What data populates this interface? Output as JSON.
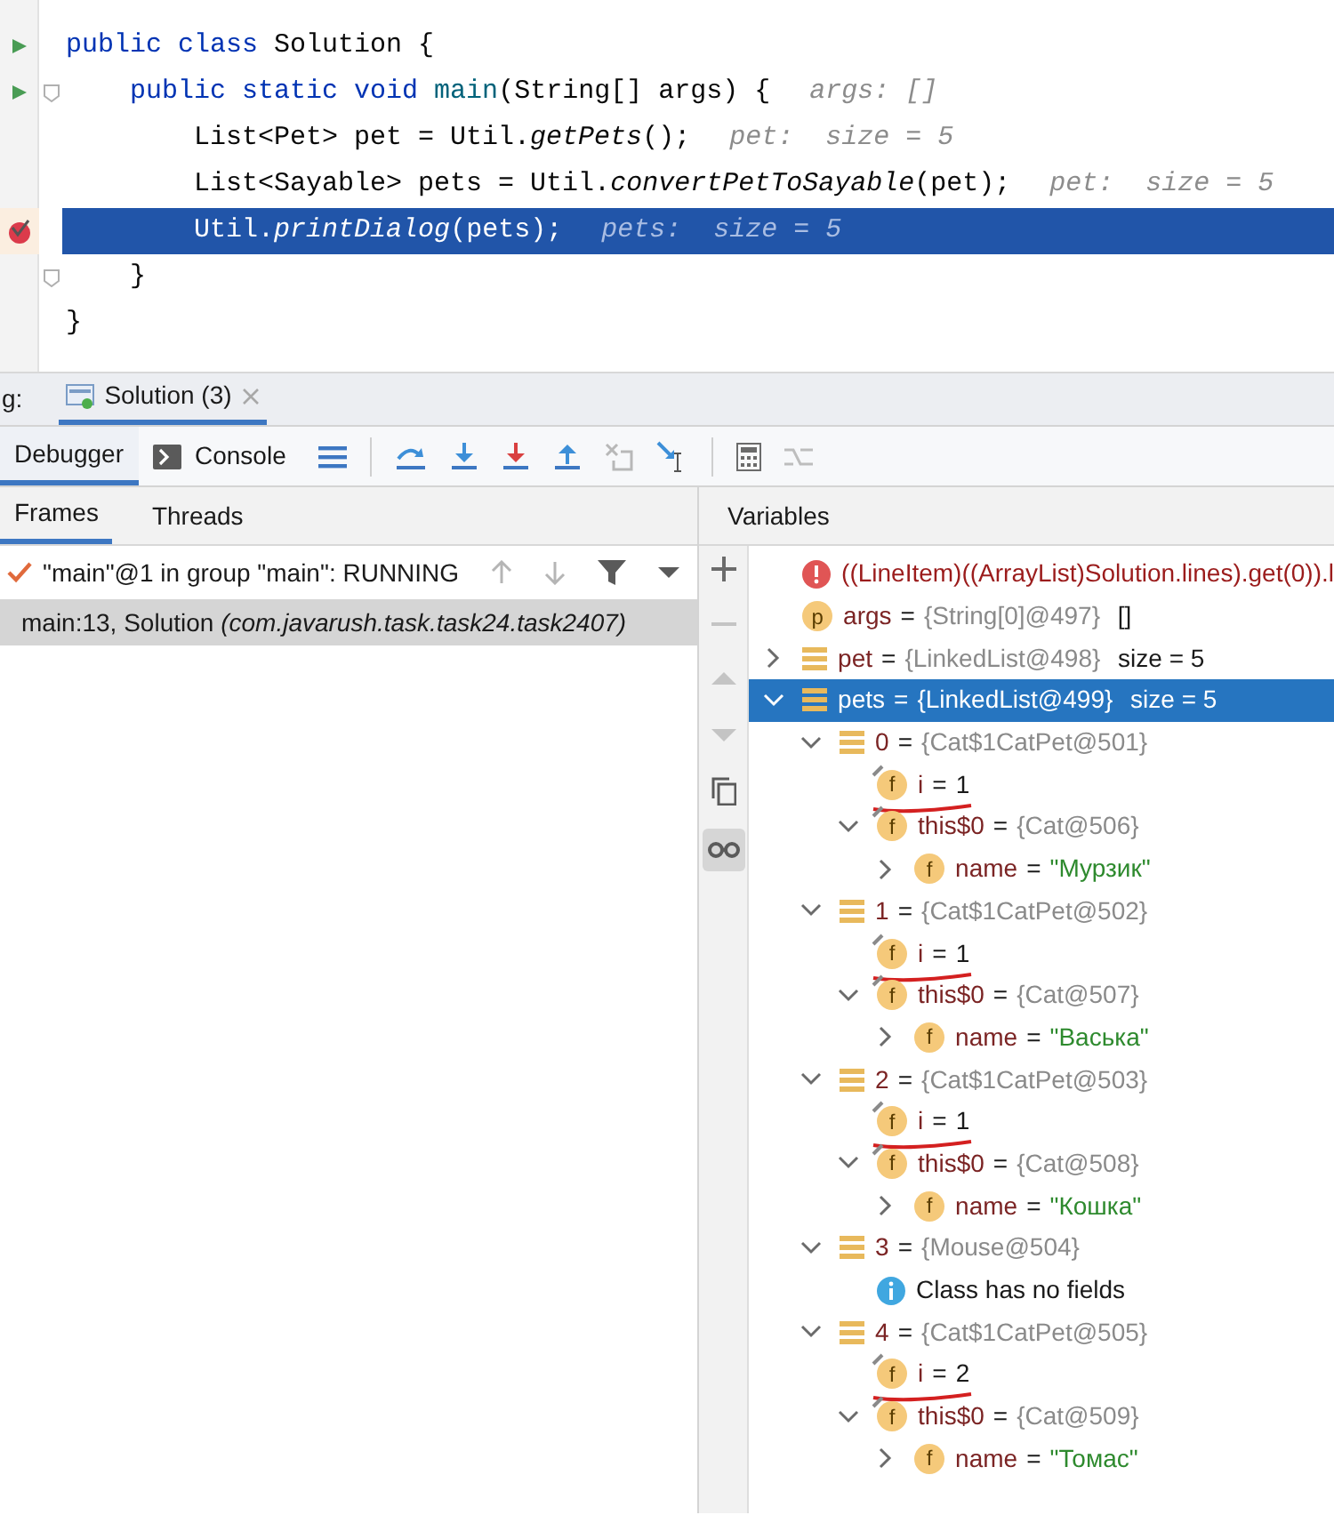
{
  "editor": {
    "lines": [
      {
        "marker": {
          "kind": "run"
        },
        "fold": false,
        "selected": false,
        "segments": [
          {
            "kind": "keyword",
            "text": "public class "
          },
          {
            "kind": "plain",
            "text": "Solution {"
          }
        ]
      },
      {
        "marker": {
          "kind": "run"
        },
        "fold": true,
        "selected": false,
        "segments": [
          {
            "kind": "keyword",
            "text": "    public static void "
          },
          {
            "kind": "decl",
            "text": "main"
          },
          {
            "kind": "plain",
            "text": "(String[] args) {"
          }
        ],
        "hint": "args: []"
      },
      {
        "fold": false,
        "selected": false,
        "segments": [
          {
            "kind": "plain",
            "text": "        List<Pet> pet = Util."
          },
          {
            "kind": "italic",
            "text": "getPets"
          },
          {
            "kind": "plain",
            "text": "();"
          }
        ],
        "hint": "pet:  size = 5"
      },
      {
        "fold": false,
        "selected": false,
        "segments": [
          {
            "kind": "plain",
            "text": "        List<Sayable> pets = Util."
          },
          {
            "kind": "italic",
            "text": "convertPetToSayable"
          },
          {
            "kind": "plain",
            "text": "(pet);"
          }
        ],
        "hint": "pet:  size = 5"
      },
      {
        "marker": {
          "kind": "breakpoint"
        },
        "fold": false,
        "selected": true,
        "segments": [
          {
            "kind": "plain",
            "text": "        Util."
          },
          {
            "kind": "italic",
            "text": "printDialog"
          },
          {
            "kind": "plain",
            "text": "(pets);"
          }
        ],
        "hint": "pets:  size = 5"
      },
      {
        "fold": true,
        "selected": false,
        "segments": [
          {
            "kind": "plain",
            "text": "    }"
          }
        ]
      },
      {
        "fold": false,
        "selected": false,
        "segments": [
          {
            "kind": "plain",
            "text": "}"
          }
        ]
      }
    ]
  },
  "debug_bar": {
    "label": "g:",
    "session_tab": {
      "label": "Solution (3)",
      "selected": true
    }
  },
  "debug_tabs": [
    {
      "label": "Debugger",
      "selected": true
    },
    {
      "label": "Console",
      "selected": false
    }
  ],
  "frames_panel": {
    "tabs": [
      {
        "label": "Frames",
        "selected": true
      },
      {
        "label": "Threads",
        "selected": false
      }
    ],
    "thread": {
      "label": "\"main\"@1 in group \"main\": RUNNING"
    },
    "frames": [
      {
        "label": "main:13, Solution *(com.javarush.task.task24.task2407)*",
        "selected": true
      }
    ]
  },
  "variables": {
    "title": "Variables",
    "tree": [
      {
        "kind": "error",
        "text": "((LineItem)((ArrayList)Solution.lines).get(0)).l",
        "selected": false
      },
      {
        "kind": "param",
        "badge": "p",
        "name": "args",
        "sep": "=",
        "value": {
          "kind": "object",
          "text": "{String[0]@497}"
        },
        "extra": "[]",
        "selected": false
      },
      {
        "kind": "list",
        "name": "pet",
        "sep": "=",
        "value": {
          "kind": "object",
          "text": "{LinkedList@498}"
        },
        "extra": "size = 5",
        "expanded": false,
        "selected": false
      },
      {
        "kind": "list",
        "name": "pets",
        "sep": "=",
        "value": {
          "kind": "object",
          "text": "{LinkedList@499}"
        },
        "extra": "size = 5",
        "expanded": true,
        "selected": true,
        "children": [
          {
            "kind": "list",
            "name": "0",
            "sep": "=",
            "value": {
              "kind": "object",
              "text": "{Cat$1CatPet@501}"
            },
            "expanded": true,
            "selected": false,
            "children": [
              {
                "kind": "field",
                "badge": "f",
                "final": true,
                "underlined": true,
                "name": "i",
                "sep": "=",
                "value": {
                  "kind": "primitive",
                  "text": "1"
                },
                "selected": false
              },
              {
                "kind": "field",
                "badge": "f",
                "final": true,
                "name": "this$0",
                "sep": "=",
                "value": {
                  "kind": "object",
                  "text": "{Cat@506}"
                },
                "expanded": true,
                "selected": false,
                "children": [
                  {
                    "kind": "field",
                    "badge": "f",
                    "name": "name",
                    "sep": "=",
                    "value": {
                      "kind": "string",
                      "text": "\"Мурзик\""
                    },
                    "expanded": false,
                    "selected": false
                  }
                ]
              }
            ]
          },
          {
            "kind": "list",
            "name": "1",
            "sep": "=",
            "value": {
              "kind": "object",
              "text": "{Cat$1CatPet@502}"
            },
            "expanded": true,
            "selected": false,
            "children": [
              {
                "kind": "field",
                "badge": "f",
                "final": true,
                "underlined": true,
                "name": "i",
                "sep": "=",
                "value": {
                  "kind": "primitive",
                  "text": "1"
                },
                "selected": false
              },
              {
                "kind": "field",
                "badge": "f",
                "final": true,
                "name": "this$0",
                "sep": "=",
                "value": {
                  "kind": "object",
                  "text": "{Cat@507}"
                },
                "expanded": true,
                "selected": false,
                "children": [
                  {
                    "kind": "field",
                    "badge": "f",
                    "name": "name",
                    "sep": "=",
                    "value": {
                      "kind": "string",
                      "text": "\"Васька\""
                    },
                    "expanded": false,
                    "selected": false
                  }
                ]
              }
            ]
          },
          {
            "kind": "list",
            "name": "2",
            "sep": "=",
            "value": {
              "kind": "object",
              "text": "{Cat$1CatPet@503}"
            },
            "expanded": true,
            "selected": false,
            "children": [
              {
                "kind": "field",
                "badge": "f",
                "final": true,
                "underlined": true,
                "name": "i",
                "sep": "=",
                "value": {
                  "kind": "primitive",
                  "text": "1"
                },
                "selected": false
              },
              {
                "kind": "field",
                "badge": "f",
                "final": true,
                "name": "this$0",
                "sep": "=",
                "value": {
                  "kind": "object",
                  "text": "{Cat@508}"
                },
                "expanded": true,
                "selected": false,
                "children": [
                  {
                    "kind": "field",
                    "badge": "f",
                    "name": "name",
                    "sep": "=",
                    "value": {
                      "kind": "string",
                      "text": "\"Кошка\""
                    },
                    "expanded": false,
                    "selected": false
                  }
                ]
              }
            ]
          },
          {
            "kind": "list",
            "name": "3",
            "sep": "=",
            "value": {
              "kind": "object",
              "text": "{Mouse@504}"
            },
            "expanded": true,
            "selected": false,
            "children": [
              {
                "kind": "info",
                "text": "Class has no fields",
                "selected": false
              }
            ]
          },
          {
            "kind": "list",
            "name": "4",
            "sep": "=",
            "value": {
              "kind": "object",
              "text": "{Cat$1CatPet@505}"
            },
            "expanded": true,
            "selected": false,
            "children": [
              {
                "kind": "field",
                "badge": "f",
                "final": true,
                "underlined": true,
                "name": "i",
                "sep": "=",
                "value": {
                  "kind": "primitive",
                  "text": "2"
                },
                "selected": false
              },
              {
                "kind": "field",
                "badge": "f",
                "final": true,
                "name": "this$0",
                "sep": "=",
                "value": {
                  "kind": "object",
                  "text": "{Cat@509}"
                },
                "expanded": true,
                "selected": false,
                "children": [
                  {
                    "kind": "field",
                    "badge": "f",
                    "name": "name",
                    "sep": "=",
                    "value": {
                      "kind": "string",
                      "text": "\"Томас\""
                    },
                    "expanded": false,
                    "selected": false
                  }
                ]
              }
            ]
          }
        ]
      }
    ]
  }
}
